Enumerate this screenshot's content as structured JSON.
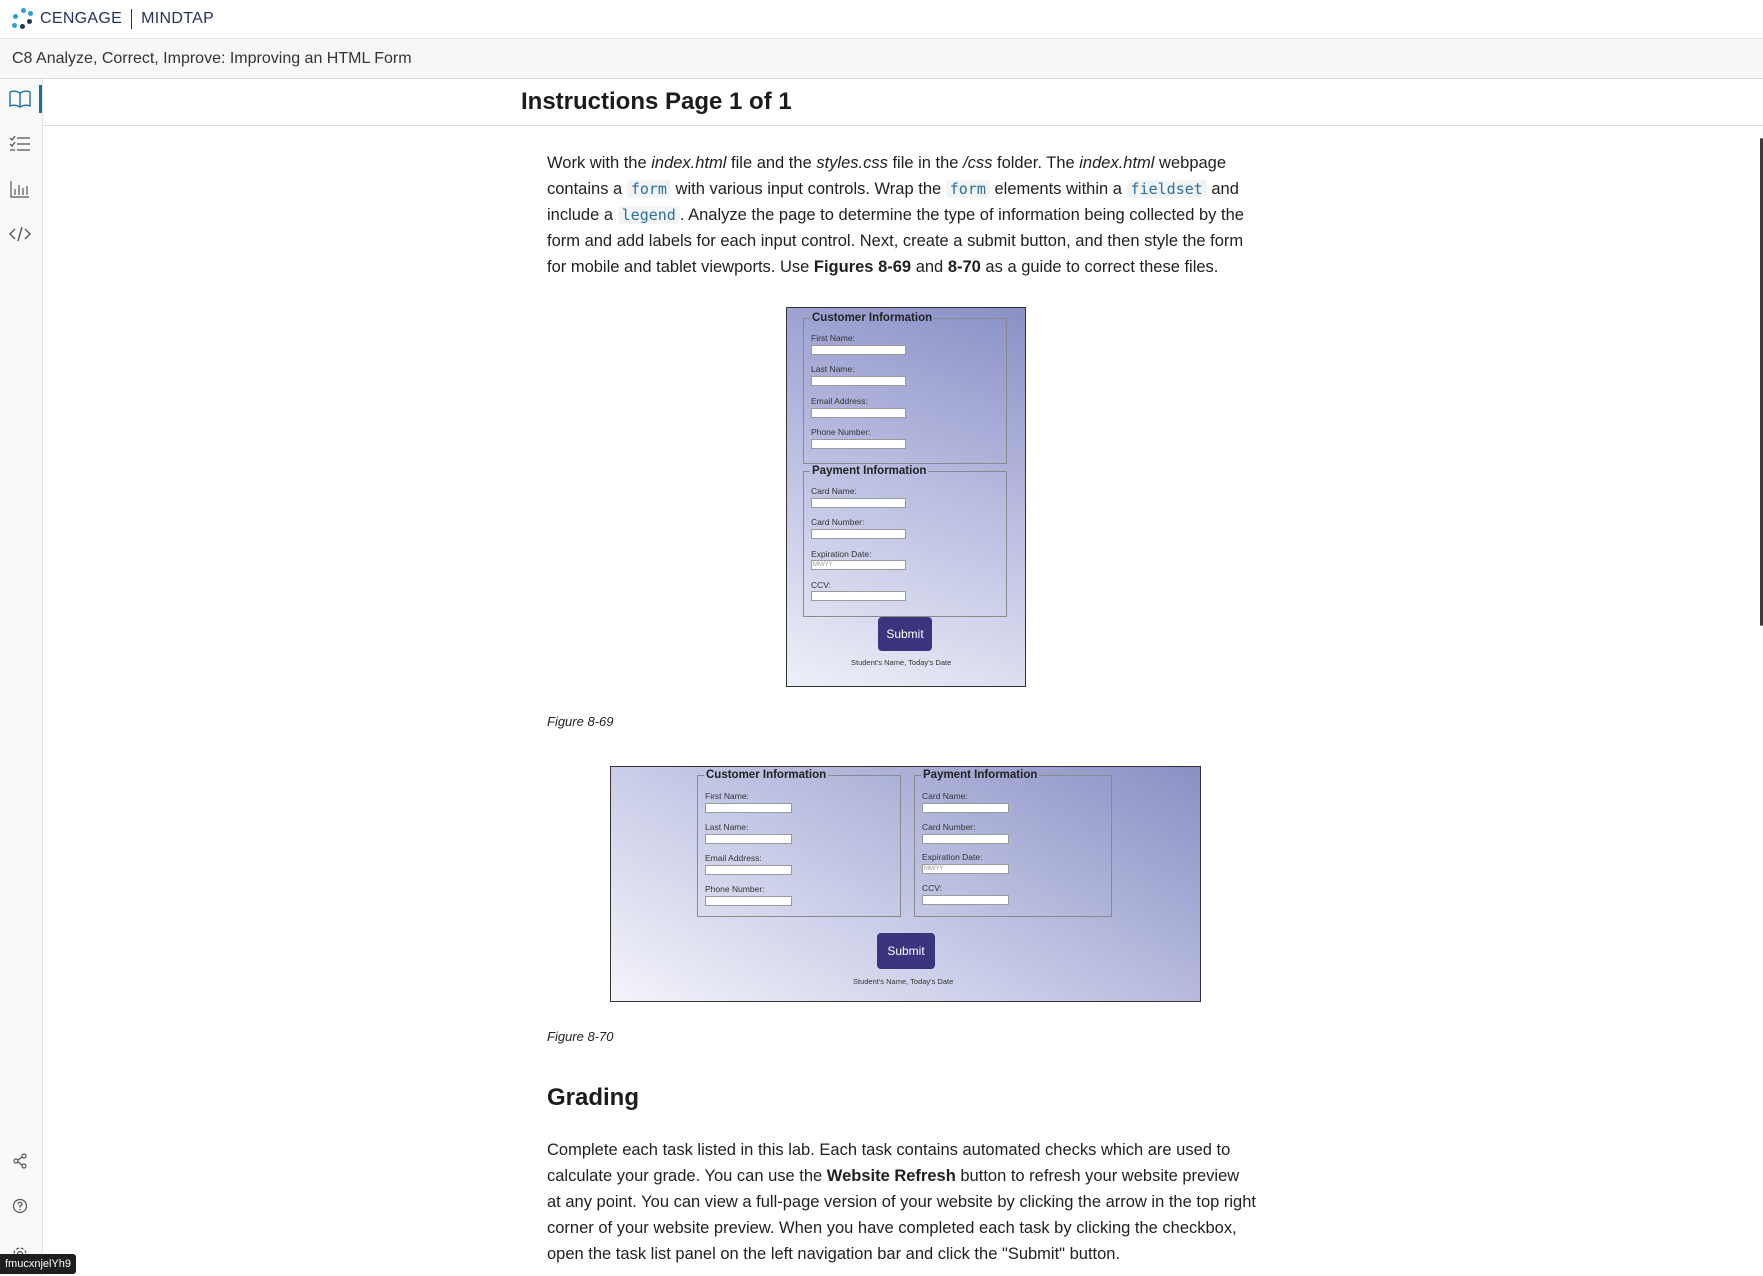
{
  "header": {
    "brand_left": "CENGAGE",
    "brand_right": "MINDTAP"
  },
  "titlebar": {
    "title": "C8 Analyze, Correct, Improve: Improving an HTML Form"
  },
  "instructions": {
    "title": "Instructions Page 1 of 1",
    "p1": {
      "t1": "Work with the ",
      "f1": "index.html",
      "t2": " file and the ",
      "f2": "styles.css",
      "t3": " file in the ",
      "f3": "/css",
      "t4": " folder. The ",
      "f4": "index.html",
      "t5": " webpage contains a ",
      "c1": "form",
      "t6": " with various input controls. Wrap the ",
      "c2": "form",
      "t7": " elements within a ",
      "c3": "fieldset",
      "t8": " and include a ",
      "c4": "legend",
      "t9": ". Analyze the page to determine the type of information being collected by the form and add labels for each input control. Next, create a submit button, and then style the form for mobile and tablet viewports. Use ",
      "b1": "Figures 8-69",
      "t10": " and ",
      "b2": "8-70",
      "t11": " as a guide to correct these files."
    },
    "figure1_caption": "Figure 8-69",
    "figure2_caption": "Figure 8-70",
    "grading_heading": "Grading",
    "grading_p": {
      "t1": "Complete each task listed in this lab. Each task contains automated checks which are used to calculate your grade. You can use the ",
      "b1": "Website Refresh",
      "t2": " button to refresh your website preview at any point. You can view a full-page version of your website by clicking the arrow in the top right corner of your website preview. When you have completed each task by clicking the checkbox, open the task list panel on the left navigation bar and click the \"Submit\" button."
    }
  },
  "form_figure": {
    "customer_legend": "Customer Information",
    "payment_legend": "Payment Information",
    "first_name": "First Name:",
    "last_name": "Last Name:",
    "email": "Email Address:",
    "phone": "Phone Number:",
    "card_name": "Card Name:",
    "card_number": "Card Number:",
    "expiration": "Expiration Date:",
    "expiration_placeholder": "MM/YY",
    "ccv": "CCV:",
    "submit": "Submit",
    "footer": "Student's Name, Today's Date"
  },
  "rail": {
    "top_icons": [
      "book-icon",
      "task-list-icon",
      "chart-icon",
      "code-icon"
    ],
    "bottom_icons": [
      "share-icon",
      "help-icon",
      "settings-icon"
    ]
  },
  "tooltip": "fmucxnjelYh9",
  "colors": {
    "accent": "#1d6ea8",
    "brand": "#26325a",
    "submit": "#3b3580",
    "code": "#2b6f9e"
  }
}
